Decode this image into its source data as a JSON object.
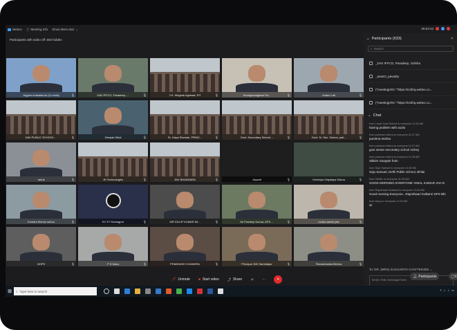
{
  "topbar": {
    "app_name": "Webex",
    "meeting_info": "Meeting Info",
    "menu_bar": "Show Menu Bar",
    "time": "05:53:43"
  },
  "sub_header": "Participants with video off: 603 hidden",
  "tiles": [
    {
      "label": "Jnjgam nndsadeum (Co-host)",
      "kind": "face",
      "bg": "#7fa1c9"
    },
    {
      "label": "DAV IFFCO, Paradeep, ...",
      "kind": "face",
      "bg": "#6a7a6a"
    },
    {
      "label": "Y.K. Mrigank Agrawal, PO",
      "kind": "classroom",
      "bg": "#3b4a55"
    },
    {
      "label": "Ahongshangbam Su...",
      "kind": "face",
      "bg": "#c7c1b5"
    },
    {
      "label": "Anand Lall",
      "kind": "face",
      "bg": "#9da7b0"
    },
    {
      "label": "DAV PUBLIC SCHOOL ...",
      "kind": "classroom",
      "bg": "#4b4a44"
    },
    {
      "label": "Deepak Dikal",
      "kind": "face",
      "bg": "#4a6270"
    },
    {
      "label": "Dr. Gaya Ravulan, PRINC...",
      "kind": "classroom",
      "bg": "#6a5a4e"
    },
    {
      "label": "Govt. Secondary School ...",
      "kind": "classroom",
      "bg": "#5a6c74"
    },
    {
      "label": "Govt. Sr. Sec. School, pali...",
      "kind": "classroom",
      "bg": "#6f6a66"
    },
    {
      "label": "rahull",
      "kind": "face",
      "bg": "#8b8f96"
    },
    {
      "label": "JK Technologies",
      "kind": "classroom",
      "bg": "#7a8a6a"
    },
    {
      "label": "JNV BHANDARA",
      "kind": "classroom",
      "bg": "#6fa0b8"
    },
    {
      "label": "Jayanti",
      "kind": "plain",
      "bg": "#1e1e1e"
    },
    {
      "label": "Kendriya Vidyalaya Sukna",
      "kind": "plain",
      "bg": "#3f4c44"
    },
    {
      "label": "Kshetra Mohan sahoo",
      "kind": "face",
      "bg": "#8c9aa2"
    },
    {
      "label": "KV ST Kharagpur",
      "kind": "obs",
      "bg": "#2a2f4a"
    },
    {
      "label": "MR DILLIP KUMAR MI...",
      "kind": "face",
      "bg": "#4c4c4c"
    },
    {
      "label": "Mr Pradeep Kumar, APS ...",
      "kind": "face",
      "bg": "#6c7a62"
    },
    {
      "label": "mudra ashok jain",
      "kind": "face",
      "bg": "#bcb6ac"
    },
    {
      "label": "NOPS",
      "kind": "face",
      "bg": "#5e5e5e"
    },
    {
      "label": "P S Kalra",
      "kind": "face",
      "bg": "#a7a9a9"
    },
    {
      "label": "PRABHASH CHANDRA",
      "kind": "face",
      "bg": "#5b4c44"
    },
    {
      "label": "Principal JNV Sambalpur",
      "kind": "face",
      "bg": "#7a6a58"
    },
    {
      "label": "Ramashwaka Meena",
      "kind": "face",
      "bg": "#8d8e86"
    }
  ],
  "panel": {
    "title": "Participants (633)",
    "search_placeholder": "Search",
    "participants": [
      "_DAV IFFCO, Paradeep, Odisha",
      "_anasO_pavadry",
      "(\"meetingURL\":\"https://ncbhq.webex.co...",
      "(\"meetingURL\":\"https://ncbhq.webex.co..."
    ],
    "chat_title": "Chat",
    "messages": [
      {
        "from": "from Lower Suel School to everyone   11:25 AM",
        "text": "having problem with audio"
      },
      {
        "from": "from purnima mishra to everyone   11:27 AM",
        "text": "purnima mishra"
      },
      {
        "from": "from purnima mishra to everyone   11:27 AM",
        "text": "govt senior secondary school sichey"
      },
      {
        "from": "from purnima mishra to everyone   11:28 AM",
        "text": "Sikkim Gangtok frotn"
      },
      {
        "from": "from Soju Samuel to everyone   11:28 AM",
        "text": "Soju Samuel, Delhi Public School, Bhilai"
      },
      {
        "from": "from VIMAL to everyone   11:29 AM",
        "text": "GOOD MORNING EVERYONE  VIMAL KUMAR JHA D"
      },
      {
        "from": "from Rajeshwari Kulkarni to everyone   11:29 AM",
        "text": "Good morning Everyone...Rajeshwari Kulkarni DPS Bhi"
      },
      {
        "from": "from Anup to everyone   11:29 AM",
        "text": "sir"
      }
    ],
    "to_label": "To:",
    "to_value": "DR. (MRS) SUCHARITA CHATTERJEE",
    "input_placeholder": "Enter chat message here"
  },
  "controls": {
    "unmute": "Unmute",
    "start_video": "Start video",
    "share": "Share",
    "participants": "Participants",
    "chat": "Ch"
  },
  "taskbar": {
    "search_placeholder": "Type here to search"
  }
}
